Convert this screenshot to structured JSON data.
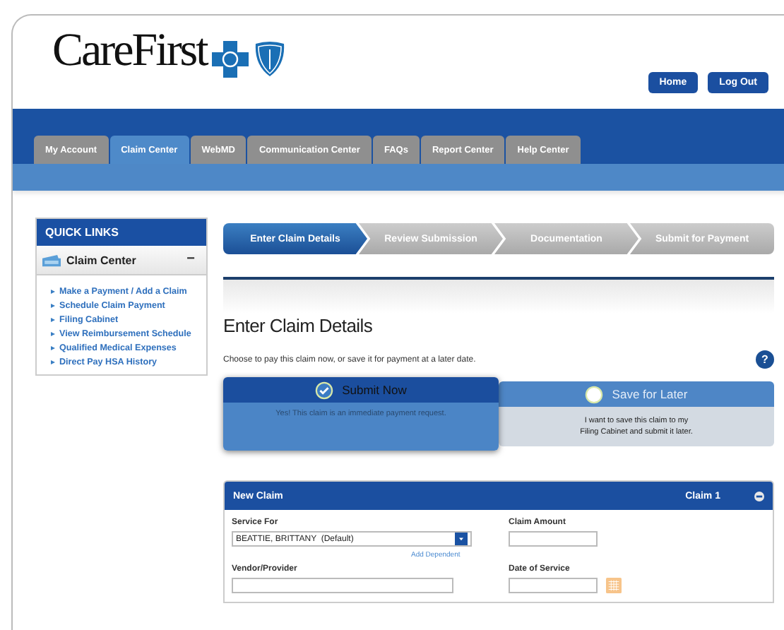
{
  "logo": {
    "text": "CareFirst"
  },
  "header_buttons": [
    "Home",
    "Log Out"
  ],
  "tabs": [
    {
      "label": "My Account",
      "selected": false
    },
    {
      "label": "Claim Center",
      "selected": true
    },
    {
      "label": "WebMD",
      "selected": false
    },
    {
      "label": "Communication Center",
      "selected": false
    },
    {
      "label": "FAQs",
      "selected": false
    },
    {
      "label": "Report Center",
      "selected": false
    },
    {
      "label": "Help Center",
      "selected": false
    }
  ],
  "quick_links": {
    "title": "QUICK LINKS",
    "section": "Claim Center",
    "toggle": "−",
    "links": [
      "Make a Payment / Add a Claim",
      "Schedule Claim Payment",
      "Filing Cabinet",
      "View Reimbursement Schedule",
      "Qualified Medical Expenses",
      "Direct Pay HSA History"
    ]
  },
  "steps": [
    {
      "label": "Enter Claim Details",
      "selected": true
    },
    {
      "label": "Review Submission",
      "selected": false
    },
    {
      "label": "Documentation",
      "selected": false
    },
    {
      "label": "Submit for Payment",
      "selected": false
    }
  ],
  "page_title": "Enter Claim Details",
  "instructions": "Choose to pay this claim now, or save it for payment at a later date.",
  "help": "?",
  "options": [
    {
      "title": "Submit Now",
      "lines": [
        "Yes! This claim is an immediate payment request."
      ],
      "selected": true
    },
    {
      "title": "Save for Later",
      "lines": [
        "I want to save this claim to my",
        "Filing Cabinet and submit it later."
      ],
      "selected": false
    }
  ],
  "claim": {
    "title": "New Claim",
    "number": "Claim 1",
    "fields": [
      {
        "label": "Service For",
        "kind": "select",
        "value": "BEATTIE, BRITTANY  (Default)",
        "link": "Add Dependent"
      },
      {
        "label": "Claim Amount",
        "kind": "text"
      },
      {
        "label": "Vendor/Provider",
        "kind": "text"
      },
      {
        "label": "Date of Service",
        "kind": "date"
      }
    ]
  }
}
